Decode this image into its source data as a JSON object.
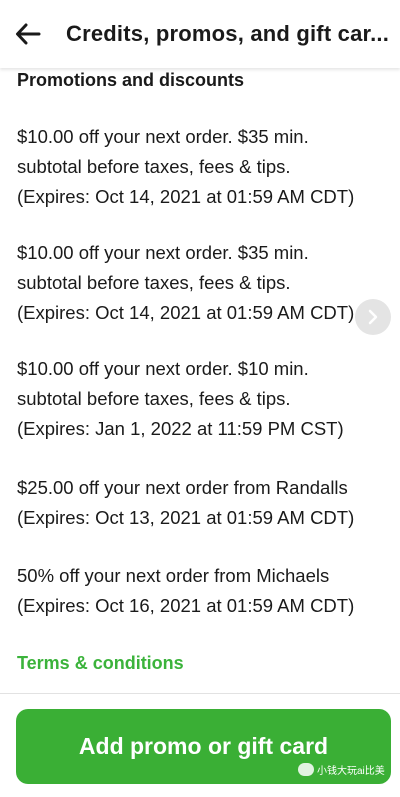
{
  "header": {
    "back_icon": "arrow-left-icon",
    "title": "Credits, promos, and gift car..."
  },
  "section": {
    "title": "Promotions and discounts"
  },
  "promos": [
    {
      "line1": "$10.00 off your next order. $35 min.",
      "line2": "subtotal before taxes, fees & tips.",
      "line3": "(Expires: Oct 14, 2021 at 01:59 AM CDT)"
    },
    {
      "line1": "$10.00 off your next order. $35 min.",
      "line2": "subtotal before taxes, fees & tips.",
      "line3": "(Expires: Oct 14, 2021 at 01:59 AM CDT)"
    },
    {
      "line1": "$10.00 off your next order. $10 min.",
      "line2": "subtotal before taxes, fees & tips.",
      "line3": "(Expires: Jan 1, 2022 at 11:59 PM CST)"
    },
    {
      "line1": "$25.00 off your next order from Randalls",
      "line2": "(Expires: Oct 13, 2021 at 01:59 AM CDT)"
    },
    {
      "line1": "50% off your next order from Michaels",
      "line2": "(Expires: Oct 16, 2021 at 01:59 AM CDT)"
    }
  ],
  "terms": {
    "label": "Terms & conditions"
  },
  "footer": {
    "button_label": "Add promo or gift card"
  },
  "watermark": {
    "text": "小钱大玩ai比美"
  },
  "colors": {
    "accent": "#3aaf35",
    "link": "#3bb33b",
    "text": "#1a1a1a"
  }
}
